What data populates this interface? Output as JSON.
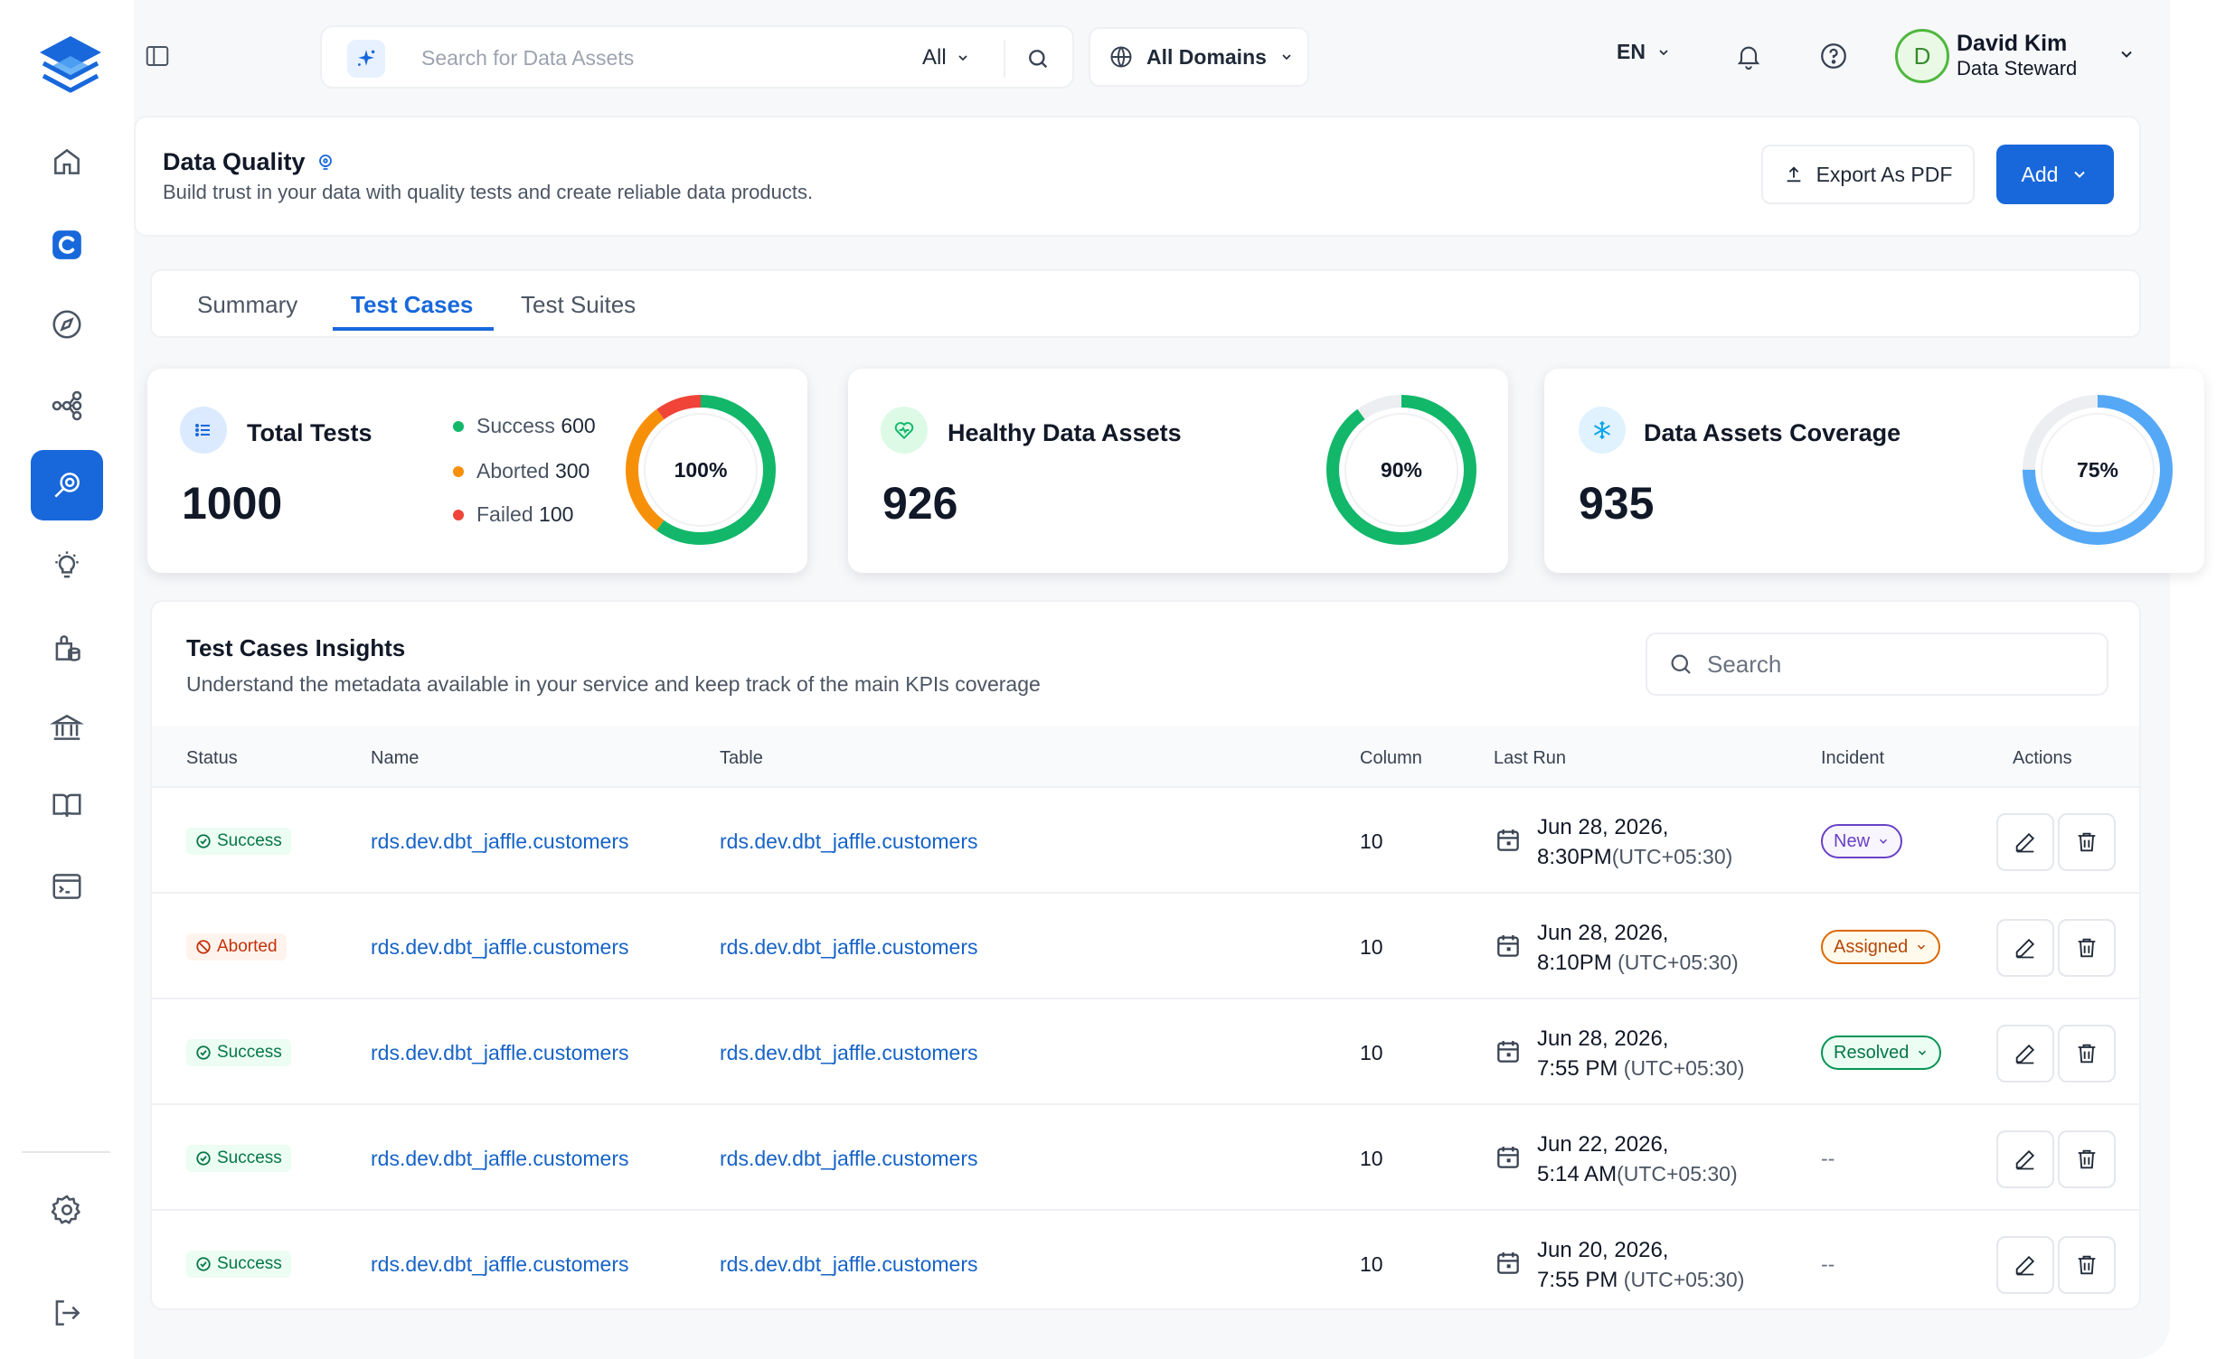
{
  "colors": {
    "brand": "#1868db",
    "success": "#12b76a",
    "aborted": "#f79009",
    "failed": "#f04438",
    "coverage": "#55a8f5"
  },
  "sidebar": {
    "items": [
      {
        "name": "home",
        "icon": "home-icon",
        "active": false
      },
      {
        "name": "collate",
        "icon": "collate-logo-icon",
        "active": false
      },
      {
        "name": "explore",
        "icon": "compass-icon",
        "active": false
      },
      {
        "name": "lineage",
        "icon": "lineage-icon",
        "active": false
      },
      {
        "name": "observability",
        "icon": "data-quality-icon",
        "active": true
      },
      {
        "name": "insights",
        "icon": "lightbulb-icon",
        "active": false
      },
      {
        "name": "domains",
        "icon": "database-bag-icon",
        "active": false
      },
      {
        "name": "governance",
        "icon": "bank-icon",
        "active": false
      },
      {
        "name": "glossary",
        "icon": "book-icon",
        "active": false
      },
      {
        "name": "api",
        "icon": "terminal-icon",
        "active": false
      }
    ],
    "bottom": [
      {
        "name": "settings",
        "icon": "gear-icon"
      },
      {
        "name": "logout",
        "icon": "logout-icon"
      }
    ]
  },
  "topbar": {
    "search_placeholder": "Search for Data Assets",
    "search_scope": "All",
    "domains_label": "All Domains",
    "language": "EN",
    "user": {
      "initial": "D",
      "name": "David Kim",
      "role": "Data Steward"
    }
  },
  "header": {
    "title": "Data Quality",
    "subtitle": "Build trust in your data with quality tests and create reliable data products.",
    "export_label": "Export As PDF",
    "add_label": "Add"
  },
  "tabs": [
    {
      "label": "Summary",
      "active": false
    },
    {
      "label": "Test Cases",
      "active": true
    },
    {
      "label": "Test Suites",
      "active": false
    }
  ],
  "stats": {
    "total": {
      "label": "Total Tests",
      "value": "1000",
      "percent_label": "100%",
      "legend": [
        {
          "name": "Success",
          "value": "600",
          "color": "#12b76a"
        },
        {
          "name": "Aborted",
          "value": "300",
          "color": "#f79009"
        },
        {
          "name": "Failed",
          "value": "100",
          "color": "#f04438"
        }
      ]
    },
    "healthy": {
      "label": "Healthy Data Assets",
      "value": "926",
      "percent": 90,
      "percent_label": "90%"
    },
    "coverage": {
      "label": "Data Assets Coverage",
      "value": "935",
      "percent": 75,
      "percent_label": "75%"
    }
  },
  "insights": {
    "title": "Test Cases Insights",
    "subtitle": "Understand the metadata available in your service and keep track of the main KPIs coverage",
    "search_placeholder": "Search",
    "columns": {
      "status": "Status",
      "name": "Name",
      "table": "Table",
      "column": "Column",
      "last_run": "Last Run",
      "incident": "Incident",
      "actions": "Actions"
    },
    "rows": [
      {
        "status": "Success",
        "name": "rds.dev.dbt_jaffle.customers",
        "table": "rds.dev.dbt_jaffle.customers",
        "column": "10",
        "date": "Jun 28, 2026,",
        "time": "8:30PM",
        "tz": "(UTC+05:30)",
        "incident": "New"
      },
      {
        "status": "Aborted",
        "name": "rds.dev.dbt_jaffle.customers",
        "table": "rds.dev.dbt_jaffle.customers",
        "column": "10",
        "date": "Jun 28, 2026,",
        "time": "8:10PM",
        "tz": " (UTC+05:30)",
        "incident": "Assigned"
      },
      {
        "status": "Success",
        "name": "rds.dev.dbt_jaffle.customers",
        "table": "rds.dev.dbt_jaffle.customers",
        "column": "10",
        "date": "Jun 28, 2026,",
        "time": "7:55 PM",
        "tz": " (UTC+05:30)",
        "incident": "Resolved"
      },
      {
        "status": "Success",
        "name": "rds.dev.dbt_jaffle.customers",
        "table": "rds.dev.dbt_jaffle.customers",
        "column": "10",
        "date": "Jun 22, 2026,",
        "time": "5:14 AM",
        "tz": "(UTC+05:30)",
        "incident": "--"
      },
      {
        "status": "Success",
        "name": "rds.dev.dbt_jaffle.customers",
        "table": "rds.dev.dbt_jaffle.customers",
        "column": "10",
        "date": "Jun 20, 2026,",
        "time": "7:55 PM",
        "tz": " (UTC+05:30)",
        "incident": "--"
      }
    ]
  }
}
